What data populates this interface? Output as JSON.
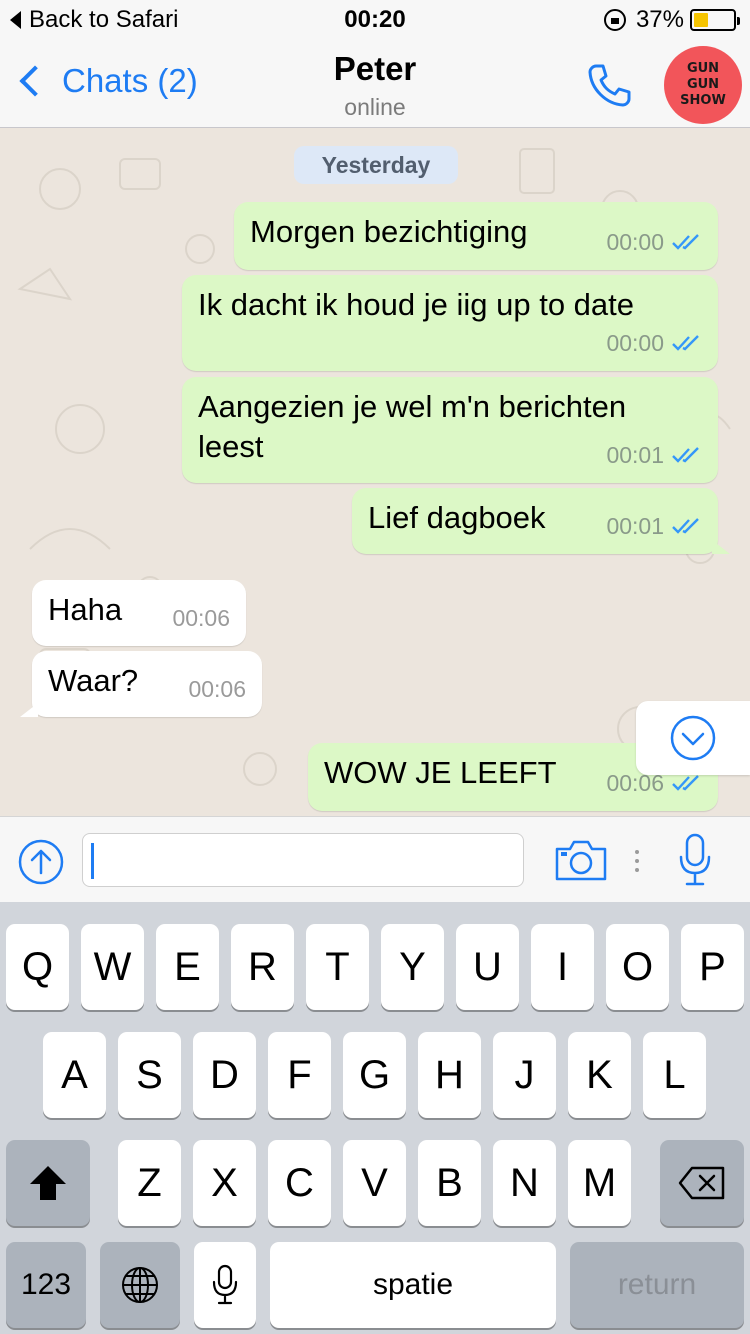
{
  "status_bar": {
    "back_label": "Back to Safari",
    "time": "00:20",
    "battery_percent_label": "37%",
    "battery_level": 0.37,
    "battery_color": "#f5c400"
  },
  "nav": {
    "back_label": "Chats (2)",
    "title": "Peter",
    "subtitle": "online",
    "call_icon": "phone-icon",
    "avatar_text": "GUN\nGUN\nSHOW",
    "accent_color": "#1e7cf3"
  },
  "chat": {
    "date_chip": "Yesterday",
    "messages": [
      {
        "direction": "out",
        "text": "Morgen bezichtiging",
        "time": "00:00"
      },
      {
        "direction": "out",
        "text": "Ik dacht ik houd je iig up to date",
        "time": "00:00"
      },
      {
        "direction": "out",
        "text": "Aangezien je wel m'n berichten leest",
        "time": "00:01"
      },
      {
        "direction": "out",
        "text": "Lief dagboek",
        "time": "00:01"
      },
      {
        "direction": "in",
        "text": "Haha",
        "time": "00:06"
      },
      {
        "direction": "in",
        "text": "Waar?",
        "time": "00:06"
      },
      {
        "direction": "out",
        "text": "WOW JE LEEFT",
        "time": "00:06"
      }
    ],
    "outgoing_color": "#dcf8c6",
    "incoming_color": "#ffffff"
  },
  "input": {
    "value": "",
    "icons": [
      "upload-icon",
      "camera-icon",
      "microphone-icon"
    ]
  },
  "keyboard": {
    "row1": [
      "Q",
      "W",
      "E",
      "R",
      "T",
      "Y",
      "U",
      "I",
      "O",
      "P"
    ],
    "row2": [
      "A",
      "S",
      "D",
      "F",
      "G",
      "H",
      "J",
      "K",
      "L"
    ],
    "row3": [
      "Z",
      "X",
      "C",
      "V",
      "B",
      "N",
      "M"
    ],
    "numbers_label": "123",
    "space_label": "spatie",
    "return_label": "return"
  }
}
